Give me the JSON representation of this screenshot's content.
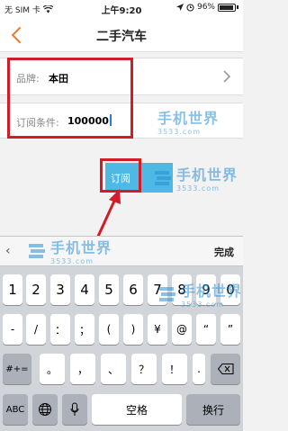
{
  "status_bar": {
    "carrier": "无 SIM 卡",
    "time": "上午9:20",
    "battery": "96%"
  },
  "nav": {
    "title": "二手汽车"
  },
  "form": {
    "brand_label": "品牌:",
    "brand_value": "本田",
    "condition_label": "订阅条件:",
    "condition_value": "100000"
  },
  "subscribe_label": "订阅",
  "watermark": {
    "text": "手机世界",
    "sub": "3533.com"
  },
  "keyboard": {
    "done_label": "完成",
    "row1": [
      "1",
      "2",
      "3",
      "4",
      "5",
      "6",
      "7",
      "8",
      "9",
      "0"
    ],
    "row2": [
      "-",
      "/",
      "：",
      "；",
      "(",
      ")",
      "¥",
      "@",
      "“",
      "”"
    ],
    "row3_shift": "#+=",
    "row3": [
      "。",
      "，",
      "、",
      "？",
      "！",
      "."
    ],
    "abc_label": "ABC",
    "space_label": "空格",
    "return_label": "换行"
  }
}
